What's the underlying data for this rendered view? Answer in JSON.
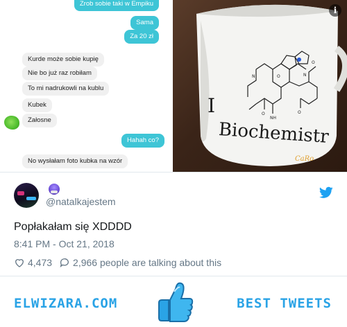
{
  "chat": {
    "messages": [
      {
        "text": "Zrob sobie taki w Empiku",
        "dir": "out"
      },
      {
        "text": "Sama",
        "dir": "out"
      },
      {
        "text": "Za 20 zł",
        "dir": "out"
      },
      {
        "text": "Kurde może sobie kupię",
        "dir": "in"
      },
      {
        "text": "Nie bo już raz robiłam",
        "dir": "in"
      },
      {
        "text": "To mi nadrukowli na kublu",
        "dir": "in"
      },
      {
        "text": "Kubek",
        "dir": "in"
      },
      {
        "text": "Załosne",
        "dir": "in"
      },
      {
        "text": "Hahah co?",
        "dir": "out"
      },
      {
        "text": "No wysłałam foto kubka na wzór",
        "dir": "in"
      }
    ]
  },
  "photo": {
    "mug_text_letter": "I",
    "mug_text_word": "Biochemistr",
    "watermark": "CaRo"
  },
  "tweet": {
    "handle": "@natalkajestem",
    "text": "Popłakałam się XDDDD",
    "date": "8:41 PM - Oct 21, 2018",
    "likes": "4,473",
    "talking": "2,966 people are talking about this"
  },
  "banner": {
    "brand": "ELWIZARA.COM",
    "tagline": "BEST TWEETS"
  },
  "colors": {
    "accent": "#2aa3e6",
    "outgoing_bubble": "#3ec5d6",
    "twitter_blue": "#1da1f2"
  }
}
